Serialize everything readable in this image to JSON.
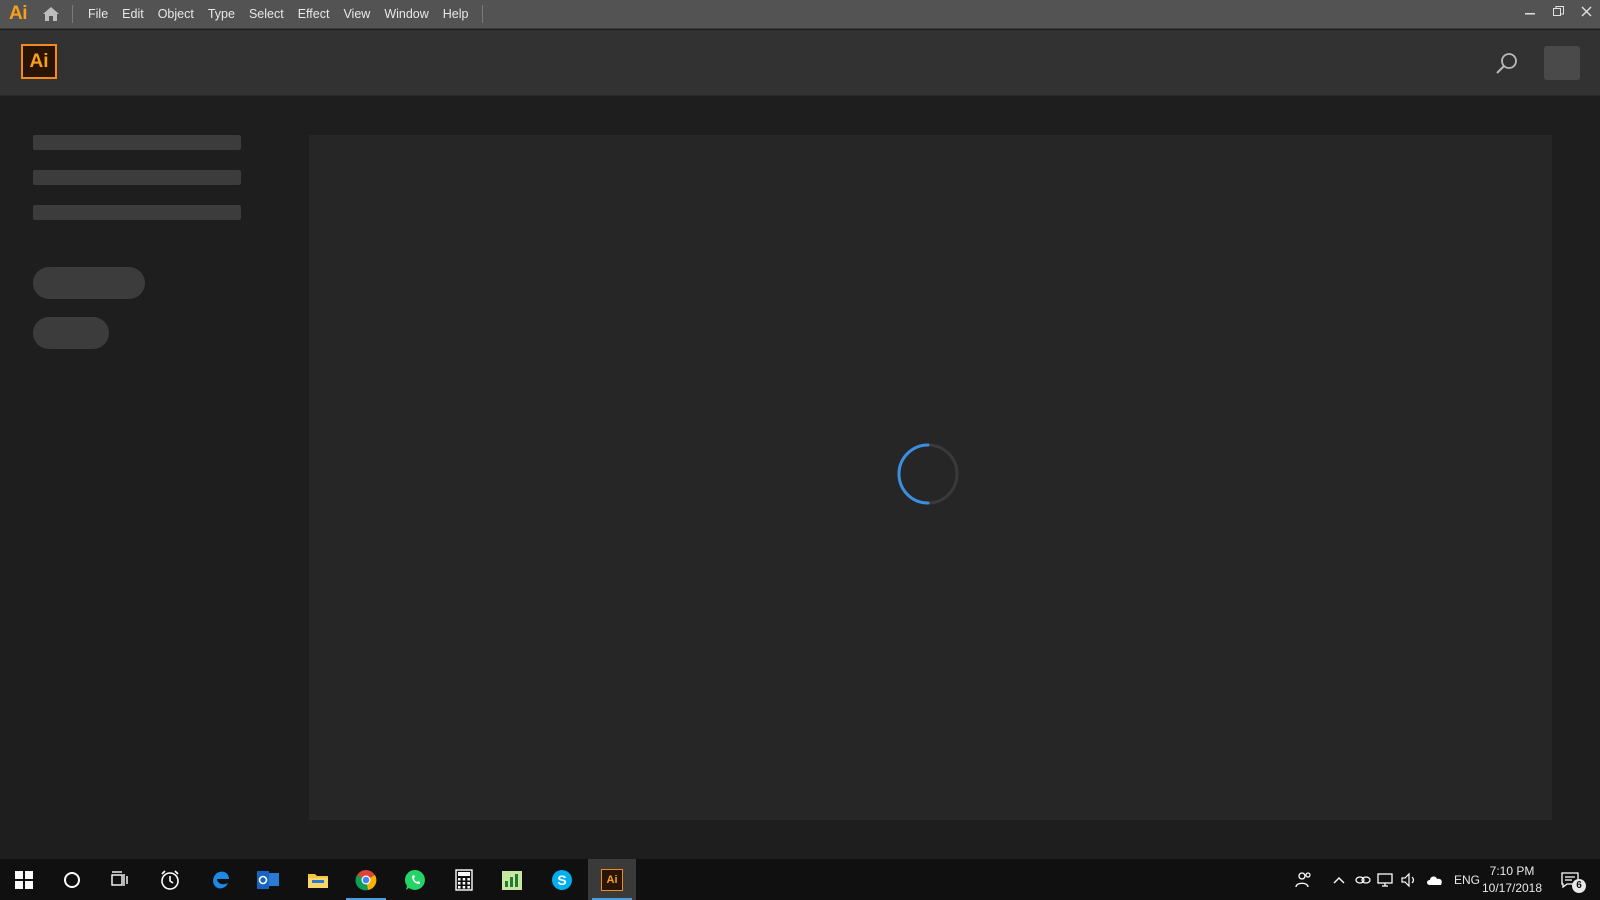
{
  "app": {
    "glyph": "Ai",
    "accent": "#f7a01e"
  },
  "menubar": {
    "items": [
      "File",
      "Edit",
      "Object",
      "Type",
      "Select",
      "Effect",
      "View",
      "Window",
      "Help"
    ]
  },
  "header": {
    "logo_text": "Ai"
  },
  "loading": {
    "spinner_color": "#3a8fe0"
  },
  "taskbar": {
    "apps": [
      {
        "name": "start-button-icon"
      },
      {
        "name": "cortana-search-icon"
      },
      {
        "name": "task-view-icon"
      },
      {
        "name": "alarms-clock-icon"
      },
      {
        "name": "edge-browser-icon"
      },
      {
        "name": "outlook-icon"
      },
      {
        "name": "file-explorer-icon"
      },
      {
        "name": "chrome-icon"
      },
      {
        "name": "whatsapp-icon"
      },
      {
        "name": "calculator-icon"
      },
      {
        "name": "excel-chart-icon"
      },
      {
        "name": "skype-icon"
      },
      {
        "name": "illustrator-taskbar-icon"
      }
    ],
    "illustrator_glyph": "Ai",
    "language": "ENG",
    "time": "7:10 PM",
    "date": "10/17/2018",
    "notification_count": "6"
  }
}
